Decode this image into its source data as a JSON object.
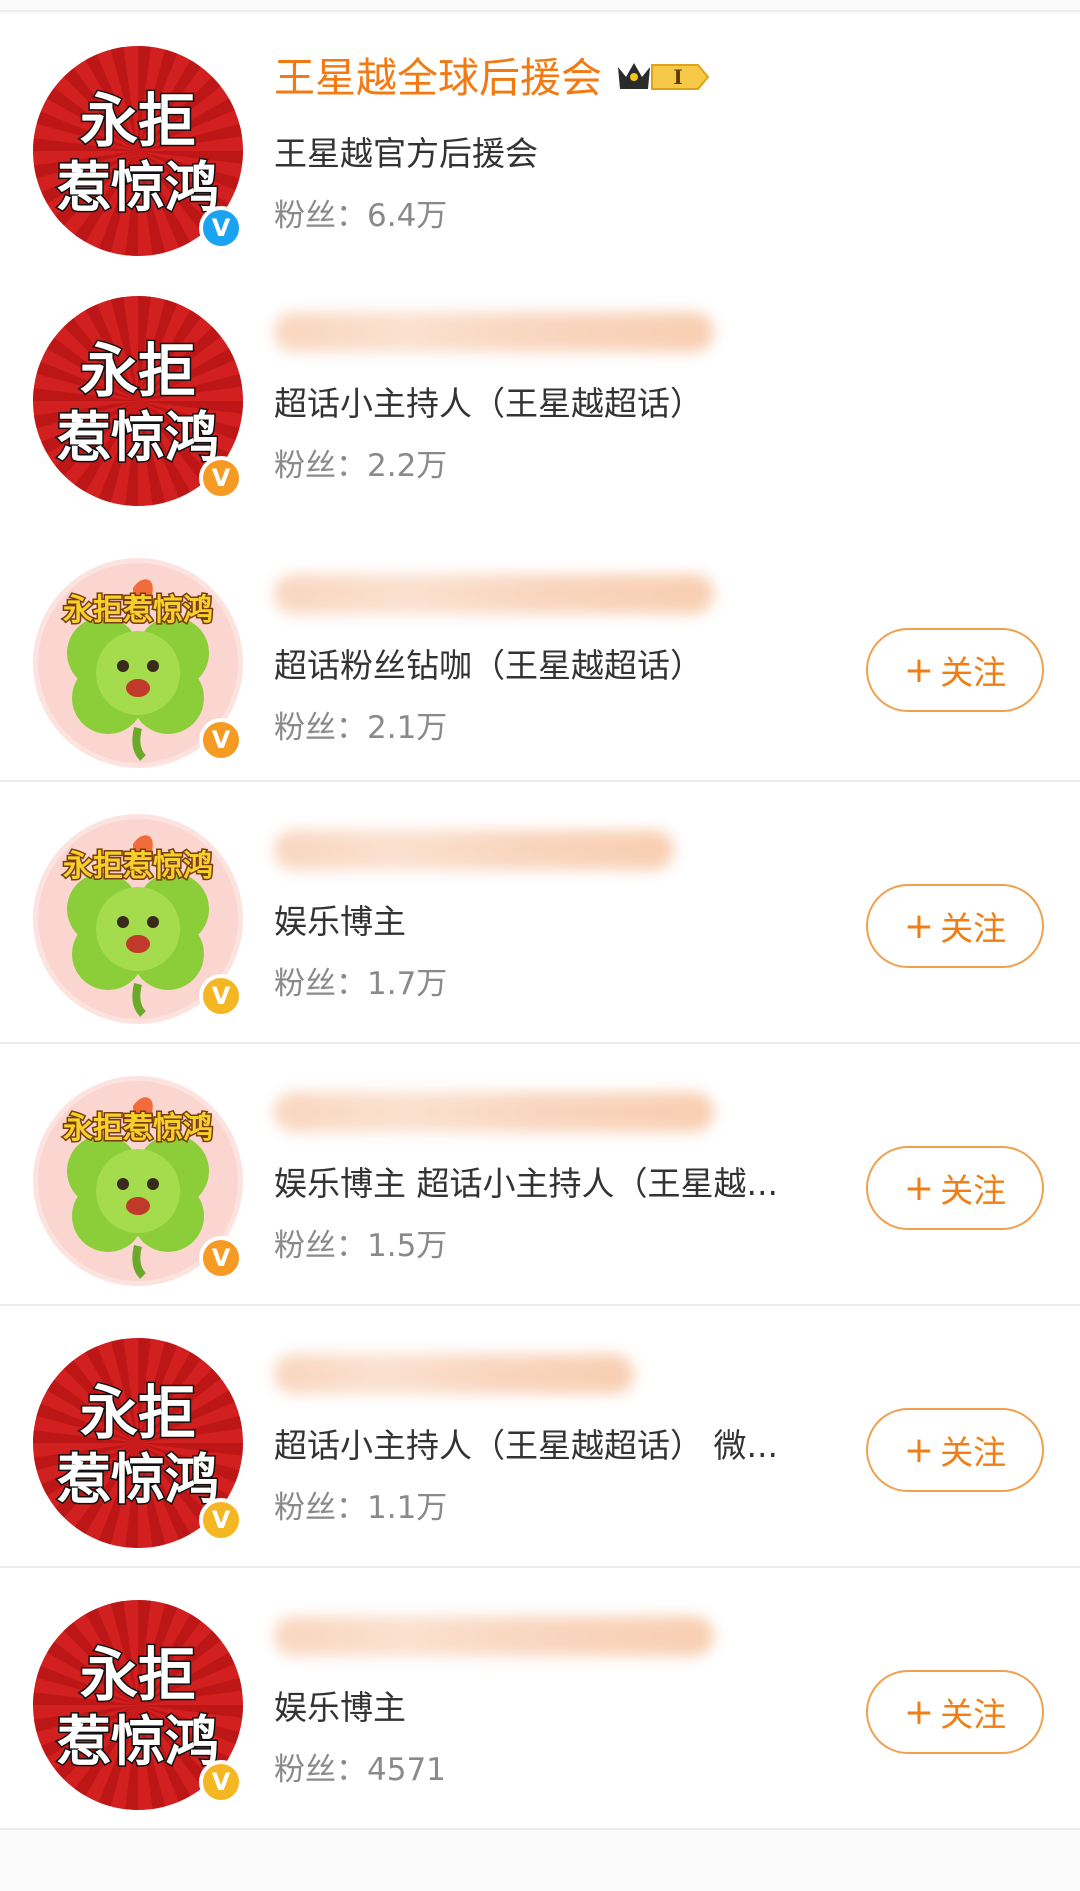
{
  "colors": {
    "name_orange": "#f37a12",
    "follow_border": "#f0a14f",
    "verified_blue": "#1aa3f0",
    "verified_orange": "#f59a23",
    "avatar_red": "#d21f1f"
  },
  "follow_label": "关注",
  "accounts": [
    {
      "name": "王星越全球后援会",
      "name_visible": true,
      "has_vip_badge": true,
      "vip_badge_text": "I",
      "avatar": "red-text-avatar",
      "avatar_text": [
        "永拒",
        "惹惊鸿"
      ],
      "verified_icon": "verified-v-icon",
      "verified_color": "blue",
      "description": "王星越官方后援会",
      "fans_label": "粉丝：",
      "fans": "6.4万",
      "show_follow": false
    },
    {
      "name_visible": false,
      "avatar": "red-text-avatar",
      "avatar_text": [
        "永拒",
        "惹惊鸿"
      ],
      "verified_icon": "verified-v-icon",
      "verified_color": "orange",
      "description": "超话小主持人（王星越超话）",
      "fans_label": "粉丝：",
      "fans": "2.2万",
      "show_follow": false
    },
    {
      "name_visible": false,
      "avatar": "clover-avatar",
      "avatar_text": [
        "永拒惹惊鸿"
      ],
      "verified_icon": "verified-v-icon",
      "verified_color": "orange",
      "description": "超话粉丝钻咖（王星越超话）",
      "fans_label": "粉丝：",
      "fans": "2.1万",
      "show_follow": true
    },
    {
      "name_visible": false,
      "avatar": "clover-avatar",
      "avatar_text": [
        "永拒惹惊鸿"
      ],
      "verified_icon": "verified-v-icon",
      "verified_color": "gold",
      "description": "娱乐博主",
      "fans_label": "粉丝：",
      "fans": "1.7万",
      "show_follow": true
    },
    {
      "name_visible": false,
      "avatar": "clover-avatar",
      "avatar_text": [
        "永拒惹惊鸿"
      ],
      "verified_icon": "verified-v-icon",
      "verified_color": "orange",
      "description": "娱乐博主 超话小主持人（王星越...",
      "fans_label": "粉丝：",
      "fans": "1.5万",
      "show_follow": true
    },
    {
      "name_visible": false,
      "avatar": "red-text-avatar",
      "avatar_text": [
        "永拒",
        "惹惊鸿"
      ],
      "verified_icon": "verified-v-icon",
      "verified_color": "gold",
      "description": "超话小主持人（王星越超话） 微...",
      "fans_label": "粉丝：",
      "fans": "1.1万",
      "show_follow": true
    },
    {
      "name_visible": false,
      "avatar": "red-text-avatar",
      "avatar_text": [
        "永拒",
        "惹惊鸿"
      ],
      "verified_icon": "verified-v-icon",
      "verified_color": "gold",
      "description": "娱乐博主",
      "fans_label": "粉丝：",
      "fans": "4571",
      "show_follow": true
    }
  ]
}
